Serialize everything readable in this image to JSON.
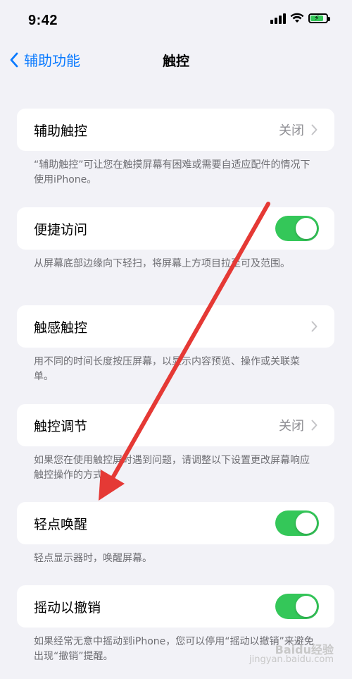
{
  "status_bar": {
    "time": "9:42"
  },
  "nav": {
    "back_label": "辅助功能",
    "title": "触控"
  },
  "groups": [
    {
      "label": "辅助触控",
      "value": "关闭",
      "footer": "“辅助触控”可让您在触摸屏幕有困难或需要自适应配件的情况下使用iPhone。"
    },
    {
      "label": "便捷访问",
      "toggle": "on",
      "footer": "从屏幕底部边缘向下轻扫，将屏幕上方项目拉至可及范围。"
    },
    {
      "label": "触感触控",
      "footer": "用不同的时间长度按压屏幕，以显示内容预览、操作或关联菜单。"
    },
    {
      "label": "触控调节",
      "value": "关闭",
      "footer": "如果您在使用触控屏时遇到问题，请调整以下设置更改屏幕响应触控操作的方式。"
    },
    {
      "label": "轻点唤醒",
      "toggle": "on",
      "footer": "轻点显示器时，唤醒屏幕。"
    },
    {
      "label": "摇动以撤销",
      "toggle": "on",
      "footer": "如果经常无意中摇动到iPhone，您可以停用“摇动以撤销”来避免出现“撤销”提醒。"
    }
  ],
  "watermark": {
    "line1": "Baidu经验",
    "line2": "jingyan.baidu.com"
  },
  "colors": {
    "accent": "#0a7aff",
    "toggle_on": "#34c759",
    "arrow": "#e53935",
    "background": "#f2f2f7"
  }
}
